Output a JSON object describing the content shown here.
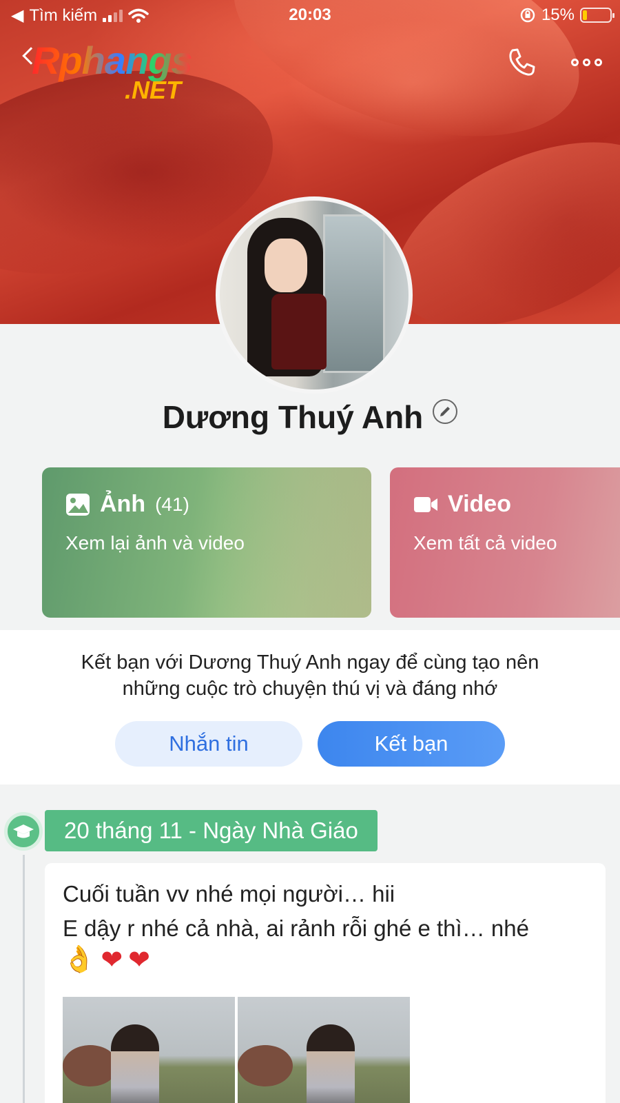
{
  "status_bar": {
    "back_app": "Tìm kiếm",
    "time": "20:03",
    "battery": "15%"
  },
  "watermark": {
    "main": "Rphangs",
    "sub": ".NET"
  },
  "profile": {
    "name": "Dương Thuý Anh"
  },
  "cards": {
    "photos": {
      "title": "Ảnh",
      "count": "(41)",
      "subtitle": "Xem lại ảnh và video"
    },
    "videos": {
      "title": "Video",
      "subtitle": "Xem tất cả video"
    }
  },
  "friend_prompt": {
    "line1": "Kết bạn với Dương Thuý Anh ngay để cùng tạo nên",
    "line2": "những cuộc trò chuyện thú vị và đáng nhớ",
    "message_button": "Nhắn tin",
    "add_friend_button": "Kết bạn"
  },
  "timeline": {
    "event_label": "20 tháng 11 - Ngày Nhà Giáo",
    "post": {
      "line1": "Cuối tuần vv nhé mọi người… hii",
      "line2": "E dậy r nhé cả nhà, ai rảnh rỗi ghé e thì… nhé",
      "emojis": [
        "👌",
        "❤",
        "❤"
      ]
    }
  },
  "icons": {
    "back": "chevron-left-icon",
    "call": "phone-icon",
    "more": "more-icon",
    "edit": "pencil-icon",
    "photos": "image-icon",
    "videos": "video-camera-icon",
    "event": "graduation-cap-icon"
  },
  "colors": {
    "primary_blue": "#3d86ee",
    "event_green": "#56bb84",
    "photos_card": "#6fa872",
    "videos_card": "#d7858f"
  }
}
